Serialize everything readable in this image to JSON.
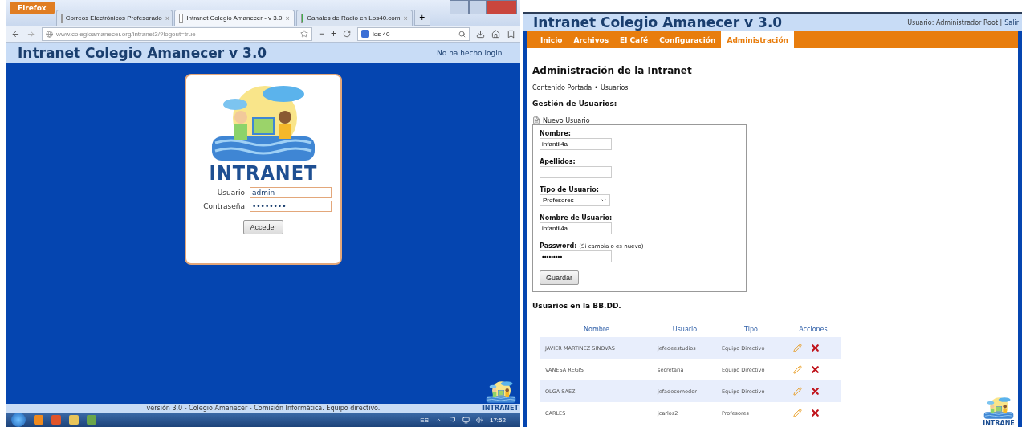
{
  "left_window": {
    "firefox_button": "Firefox",
    "tabs": [
      {
        "label": "Correos Electrónicos Profesorado",
        "close": "×",
        "selected": false
      },
      {
        "label": "Intranet Colegio Amanecer - v 3.0",
        "close": "×",
        "selected": true
      },
      {
        "label": "Canales de Radio en Los40.com",
        "close": "×",
        "selected": false
      }
    ],
    "new_tab": "+",
    "address": "www.colegioamanecer.org/intranet3/?logout=true",
    "zoom_out": "−",
    "zoom_in": "+",
    "search": "los 40",
    "site_title": "Intranet Colegio Amanecer v 3.0",
    "login_status": "No ha hecho login...",
    "login": {
      "logo_text": "INTRANET",
      "fields": [
        {
          "label": "Usuario:",
          "value": "admin"
        },
        {
          "label": "Contraseña:",
          "value": "••••••••"
        }
      ],
      "button": "Acceder"
    },
    "footer": "versión 3.0 - Colegio Amanecer - Comisión Informática. Equipo directivo.",
    "corner_logo": "INTRANET",
    "taskbar": {
      "language": "ES",
      "clock": "17:52"
    }
  },
  "right_window": {
    "site_title": "Intranet Colegio Amanecer v 3.0",
    "user_info": "Usuario: Administrador Root |",
    "logout_link": "Salir",
    "nav": [
      {
        "label": "Inicio",
        "selected": false
      },
      {
        "label": "Archivos",
        "selected": false
      },
      {
        "label": "El Café",
        "selected": false
      },
      {
        "label": "Configuración",
        "selected": false
      },
      {
        "label": "Administración",
        "selected": true
      }
    ],
    "heading": "Administración de la Intranet",
    "breadcrumb": [
      "Contenido Portada",
      "Usuarios"
    ],
    "breadcrumb_separator": "•",
    "section_title": "Gestión de Usuarios:",
    "new_user_link": "Nuevo Usuario",
    "form_fields": [
      {
        "label": "Nombre:",
        "value": "infantil4a",
        "kind": "text"
      },
      {
        "label": "Apellidos:",
        "kind": "text"
      },
      {
        "label": "Tipo de Usuario:",
        "value": "Profesores",
        "kind": "select"
      },
      {
        "label": "Nombre de Usuario:",
        "value": "infantil4a",
        "kind": "text"
      },
      {
        "label": "Password:",
        "hint": "(Si cambia o es nuevo)",
        "value": "•••••••••",
        "kind": "password"
      }
    ],
    "save_button": "Guardar",
    "users_title": "Usuarios en la BB.DD.",
    "table": {
      "columns": [
        "Nombre",
        "Usuario",
        "Tipo",
        "Acciones"
      ],
      "rows": [
        {
          "name": "JAVIER MARTINEZ SINOVAS",
          "user": "jefedeestudios",
          "type": "Equipo Directivo"
        },
        {
          "name": "VANESA REGIS",
          "user": "secretaria",
          "type": "Equipo Directivo"
        },
        {
          "name": "OLGA SAEZ",
          "user": "jefadecomedor",
          "type": "Equipo Directivo"
        },
        {
          "name": "CARLES",
          "user": "jcarlos2",
          "type": "Profesores"
        }
      ]
    },
    "corner_logo": "INTRANE"
  }
}
